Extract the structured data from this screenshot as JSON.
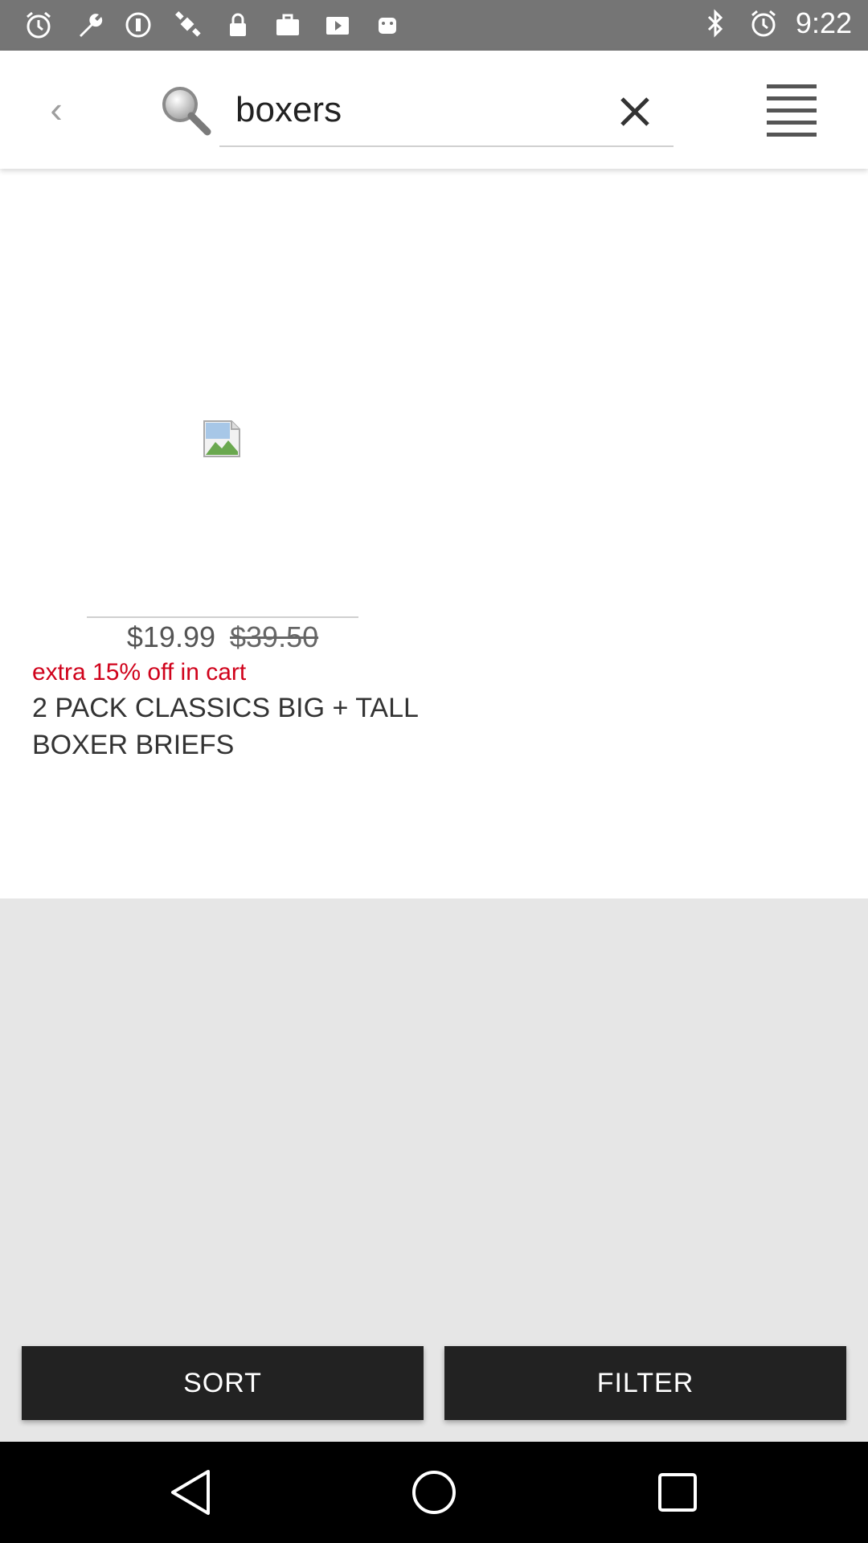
{
  "status_bar": {
    "time": "9:22",
    "left_icons": [
      "alarm-icon",
      "wrench-icon",
      "data-saver-icon",
      "satellite-icon",
      "lock-icon",
      "briefcase-icon",
      "play-store-icon",
      "android-icon"
    ],
    "right_icons": [
      "bluetooth-icon",
      "alarm-icon"
    ]
  },
  "toolbar": {
    "search_value": "boxers",
    "back_icon": "chevron-left-icon",
    "search_icon": "search-icon",
    "clear_icon": "close-icon",
    "menu_icon": "hamburger-menu-icon"
  },
  "product": {
    "price": "$19.99",
    "original_price": "$39.50",
    "promo": "extra 15% off in cart",
    "title": "2 PACK CLASSICS BIG + TALL BOXER BRIEFS",
    "image_icon": "broken-image-icon"
  },
  "actions": {
    "sort_label": "SORT",
    "filter_label": "FILTER"
  },
  "colors": {
    "promo_red": "#d0021b",
    "button_dark": "#222222",
    "status_bar": "#757575"
  },
  "nav_bar": {
    "icons": [
      "back-triangle-icon",
      "home-circle-icon",
      "recents-square-icon"
    ]
  }
}
